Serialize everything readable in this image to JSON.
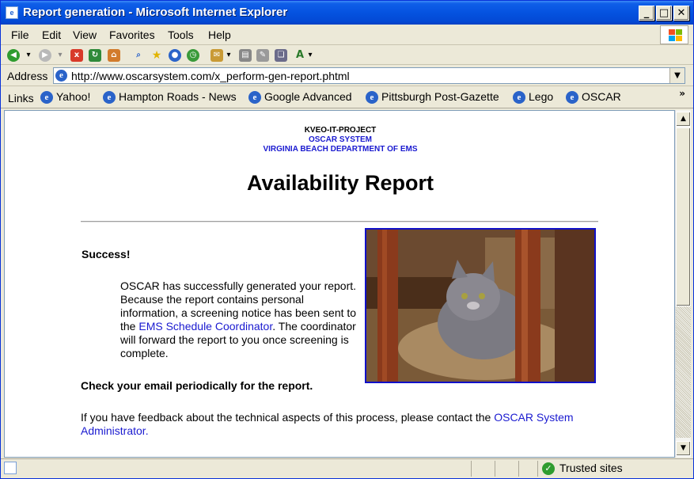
{
  "window": {
    "title": "Report generation - Microsoft Internet Explorer",
    "minimize": "_",
    "maximize": "□",
    "close": "✕"
  },
  "menu": [
    "File",
    "Edit",
    "View",
    "Favorites",
    "Tools",
    "Help"
  ],
  "address": {
    "label": "Address",
    "url": "http://www.oscarsystem.com/x_perform-gen-report.phtml"
  },
  "links": {
    "label": "Links",
    "items": [
      "Yahoo!",
      "Hampton Roads - News",
      "Google Advanced",
      "Pittsburgh Post-Gazette",
      "Lego",
      "OSCAR"
    ]
  },
  "page": {
    "org_line1": "KVEO-IT-PROJECT",
    "org_line2": "OSCAR SYSTEM",
    "org_line3": "VIRGINIA BEACH DEPARTMENT OF EMS",
    "heading": "Availability Report",
    "success": "Success!",
    "body_before_link": "OSCAR has successfully generated your report.  Because the report contains personal information, a screening notice has been sent to the ",
    "body_link": "EMS Schedule Coordinator",
    "body_after_link": ".  The coordinator will forward the report to you once screening is complete.",
    "check_email": "Check your email periodically for the report.",
    "feedback_before": "If you have feedback about the technical aspects of this process, please contact the ",
    "feedback_link": "OSCAR System Administrator",
    "feedback_after": "."
  },
  "status": {
    "zone": "Trusted sites"
  },
  "colors": {
    "link": "#1a1ad0",
    "titlebar": "#0553e0"
  }
}
